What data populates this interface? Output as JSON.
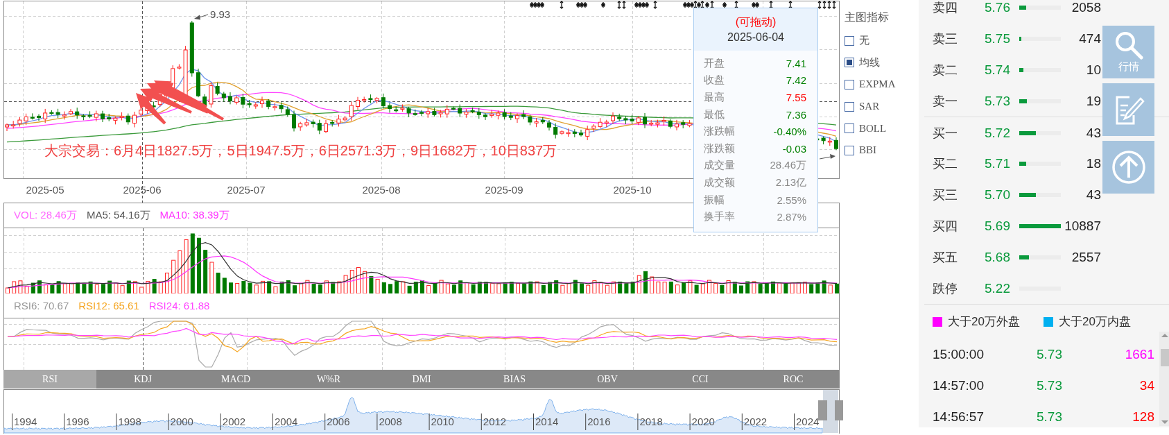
{
  "main_chart": {
    "peak_label": "9.93",
    "block_trade_note": "大宗交易：6月4日1827.5万，5日1947.5万，6日2571.3万，9日1682万，10日837万",
    "x_axis_labels": [
      "2025-05",
      "2025-06",
      "2025-07",
      "2025-08",
      "2025-09",
      "2025-10"
    ]
  },
  "tooltip": {
    "hint": "(可拖动)",
    "date": "2025-06-04",
    "rows": [
      {
        "label": "开盘",
        "value": "7.41",
        "color": "#008000"
      },
      {
        "label": "收盘",
        "value": "7.42",
        "color": "#008000"
      },
      {
        "label": "最高",
        "value": "7.55",
        "color": "#ff0000"
      },
      {
        "label": "最低",
        "value": "7.36",
        "color": "#008000"
      },
      {
        "label": "涨跌幅",
        "value": "-0.40%",
        "color": "#008000"
      },
      {
        "label": "涨跌额",
        "value": "-0.03",
        "color": "#008000"
      },
      {
        "label": "成交量",
        "value": "28.46万",
        "color": "#888888"
      },
      {
        "label": "成交额",
        "value": "2.13亿",
        "color": "#888888"
      },
      {
        "label": "振幅",
        "value": "2.55%",
        "color": "#888888"
      },
      {
        "label": "换手率",
        "value": "2.87%",
        "color": "#888888"
      }
    ]
  },
  "indicator_legend": {
    "title": "主图指标",
    "options": [
      {
        "label": "无",
        "checked": false
      },
      {
        "label": "均线",
        "checked": true
      },
      {
        "label": "EXPMA",
        "checked": false
      },
      {
        "label": "SAR",
        "checked": false
      },
      {
        "label": "BOLL",
        "checked": false
      },
      {
        "label": "BBI",
        "checked": false
      }
    ]
  },
  "volume_panel": {
    "legend": [
      {
        "text": "VOL: 28.46万",
        "color": "#ff66ff"
      },
      {
        "text": "MA5: 54.16万",
        "color": "#555555"
      },
      {
        "text": "MA10: 38.39万",
        "color": "#ff33ff"
      }
    ]
  },
  "rsi_panel": {
    "legend": [
      {
        "text": "RSI6: 70.67",
        "color": "#999999"
      },
      {
        "text": "RSI12: 65.61",
        "color": "#f5a623"
      },
      {
        "text": "RSI24: 61.88",
        "color": "#ff44ff"
      }
    ]
  },
  "indicator_tabs": [
    {
      "label": "RSI",
      "selected": true
    },
    {
      "label": "KDJ",
      "selected": false
    },
    {
      "label": "MACD",
      "selected": false
    },
    {
      "label": "W%R",
      "selected": false
    },
    {
      "label": "DMI",
      "selected": false
    },
    {
      "label": "BIAS",
      "selected": false
    },
    {
      "label": "OBV",
      "selected": false
    },
    {
      "label": "CCI",
      "selected": false
    },
    {
      "label": "ROC",
      "selected": false
    }
  ],
  "navigator": {
    "year_labels": [
      "1994",
      "1996",
      "1998",
      "2000",
      "2002",
      "2004",
      "2006",
      "2008",
      "2010",
      "2012",
      "2014",
      "2016",
      "2018",
      "2020",
      "2022",
      "2024"
    ]
  },
  "order_book": {
    "asks": [
      {
        "label": "卖四",
        "price": "5.76",
        "level": 0.17,
        "volume": "2058"
      },
      {
        "label": "卖三",
        "price": "5.75",
        "level": 0.05,
        "volume": "474"
      },
      {
        "label": "卖二",
        "price": "5.74",
        "level": 0.1,
        "volume": "10"
      },
      {
        "label": "卖一",
        "price": "5.73",
        "level": 0.18,
        "volume": "19"
      }
    ],
    "bids": [
      {
        "label": "买一",
        "price": "5.72",
        "level": 0.4,
        "volume": "43"
      },
      {
        "label": "买二",
        "price": "5.71",
        "level": 0.17,
        "volume": "18"
      },
      {
        "label": "买三",
        "price": "5.70",
        "level": 0.4,
        "volume": "43"
      },
      {
        "label": "买四",
        "price": "5.69",
        "level": 1.0,
        "volume": "10887"
      },
      {
        "label": "买五",
        "price": "5.68",
        "level": 0.23,
        "volume": "2557"
      }
    ],
    "limit_down": {
      "label": "跌停",
      "price": "5.22"
    }
  },
  "big_order_legend": [
    {
      "label": "大于20万外盘",
      "color": "#ff00ff"
    },
    {
      "label": "大于20万内盘",
      "color": "#00b0f0"
    }
  ],
  "trades": [
    {
      "time": "15:00:00",
      "price": "5.73",
      "volume": "1661",
      "color": "#ff00ff"
    },
    {
      "time": "14:57:00",
      "price": "5.73",
      "volume": "34",
      "color": "#ff0000"
    },
    {
      "time": "14:56:57",
      "price": "5.73",
      "volume": "128",
      "color": "#ff0000"
    }
  ],
  "float_buttons": [
    {
      "kind": "search",
      "label": "行情"
    },
    {
      "kind": "note"
    },
    {
      "kind": "top"
    }
  ]
}
